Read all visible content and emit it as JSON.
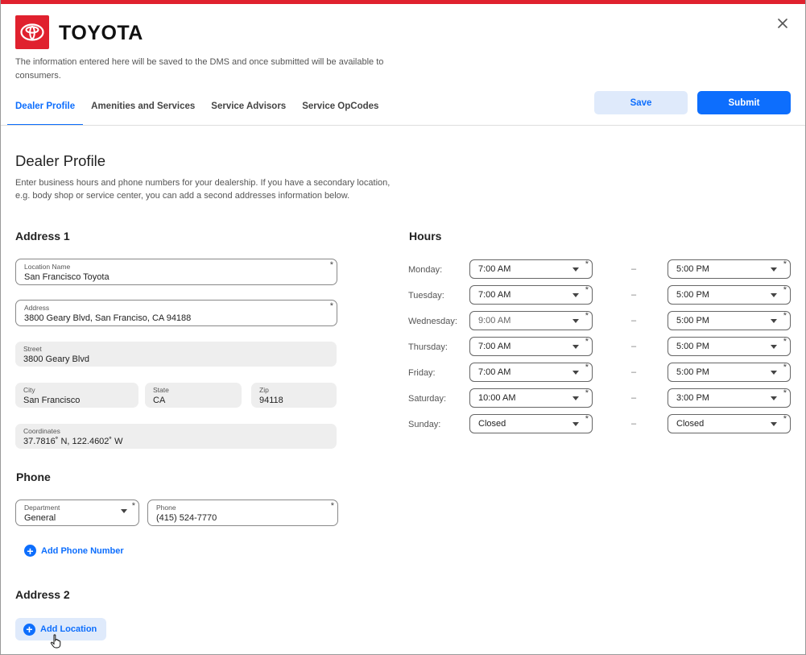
{
  "header": {
    "brand": "TOYOTA",
    "notice": "The information entered here will be saved to the DMS and once submitted will be available to consumers."
  },
  "icons": {
    "logo": "toyota-logo-icon",
    "close": "close-icon",
    "plus": "plus-circle-icon",
    "pointer": "hand-pointer-icon"
  },
  "tabs": [
    {
      "label": "Dealer Profile",
      "active": true
    },
    {
      "label": "Amenities and Services"
    },
    {
      "label": "Service Advisors"
    },
    {
      "label": "Service OpCodes"
    }
  ],
  "actions": {
    "save": "Save",
    "submit": "Submit"
  },
  "page": {
    "title": "Dealer Profile",
    "intro": "Enter business hours and phone numbers for your dealership. If you have a secondary location, e.g. body shop or service center, you can add a second addresses information below."
  },
  "address1": {
    "heading": "Address 1",
    "location_name": {
      "label": "Location Name",
      "value": "San Francisco Toyota"
    },
    "address": {
      "label": "Address",
      "value": "3800 Geary Blvd, San Franciso, CA 94188"
    },
    "street": {
      "label": "Street",
      "value": "3800 Geary Blvd"
    },
    "city": {
      "label": "City",
      "value": "San Francisco"
    },
    "state": {
      "label": "State",
      "value": "CA"
    },
    "zip": {
      "label": "Zip",
      "value": "94118"
    },
    "coordinates": {
      "label": "Coordinates",
      "value": "37.7816˚ N, 122.4602˚ W"
    }
  },
  "phone": {
    "heading": "Phone",
    "department": {
      "label": "Department",
      "value": "General"
    },
    "phone": {
      "label": "Phone",
      "value": "(415) 524-7770"
    },
    "add_label": "Add Phone Number"
  },
  "address2": {
    "heading": "Address 2",
    "add_label": "Add Location"
  },
  "hours": {
    "heading": "Hours",
    "separator": "–",
    "required_mark": "*",
    "days": [
      {
        "day": "Monday:",
        "open": "7:00 AM",
        "close": "5:00 PM"
      },
      {
        "day": "Tuesday:",
        "open": "7:00 AM",
        "close": "5:00 PM"
      },
      {
        "day": "Wednesday:",
        "open": "9:00 AM",
        "close": "5:00 PM"
      },
      {
        "day": "Thursday:",
        "open": "7:00 AM",
        "close": "5:00 PM"
      },
      {
        "day": "Friday:",
        "open": "7:00 AM",
        "close": "5:00 PM"
      },
      {
        "day": "Saturday:",
        "open": "10:00 AM",
        "close": "3:00 PM"
      },
      {
        "day": "Sunday:",
        "open": "Closed",
        "close": "Closed"
      }
    ]
  },
  "colors": {
    "brand_red": "#e0212e",
    "accent_blue": "#0d6efd",
    "save_bg": "#dfeafb"
  }
}
